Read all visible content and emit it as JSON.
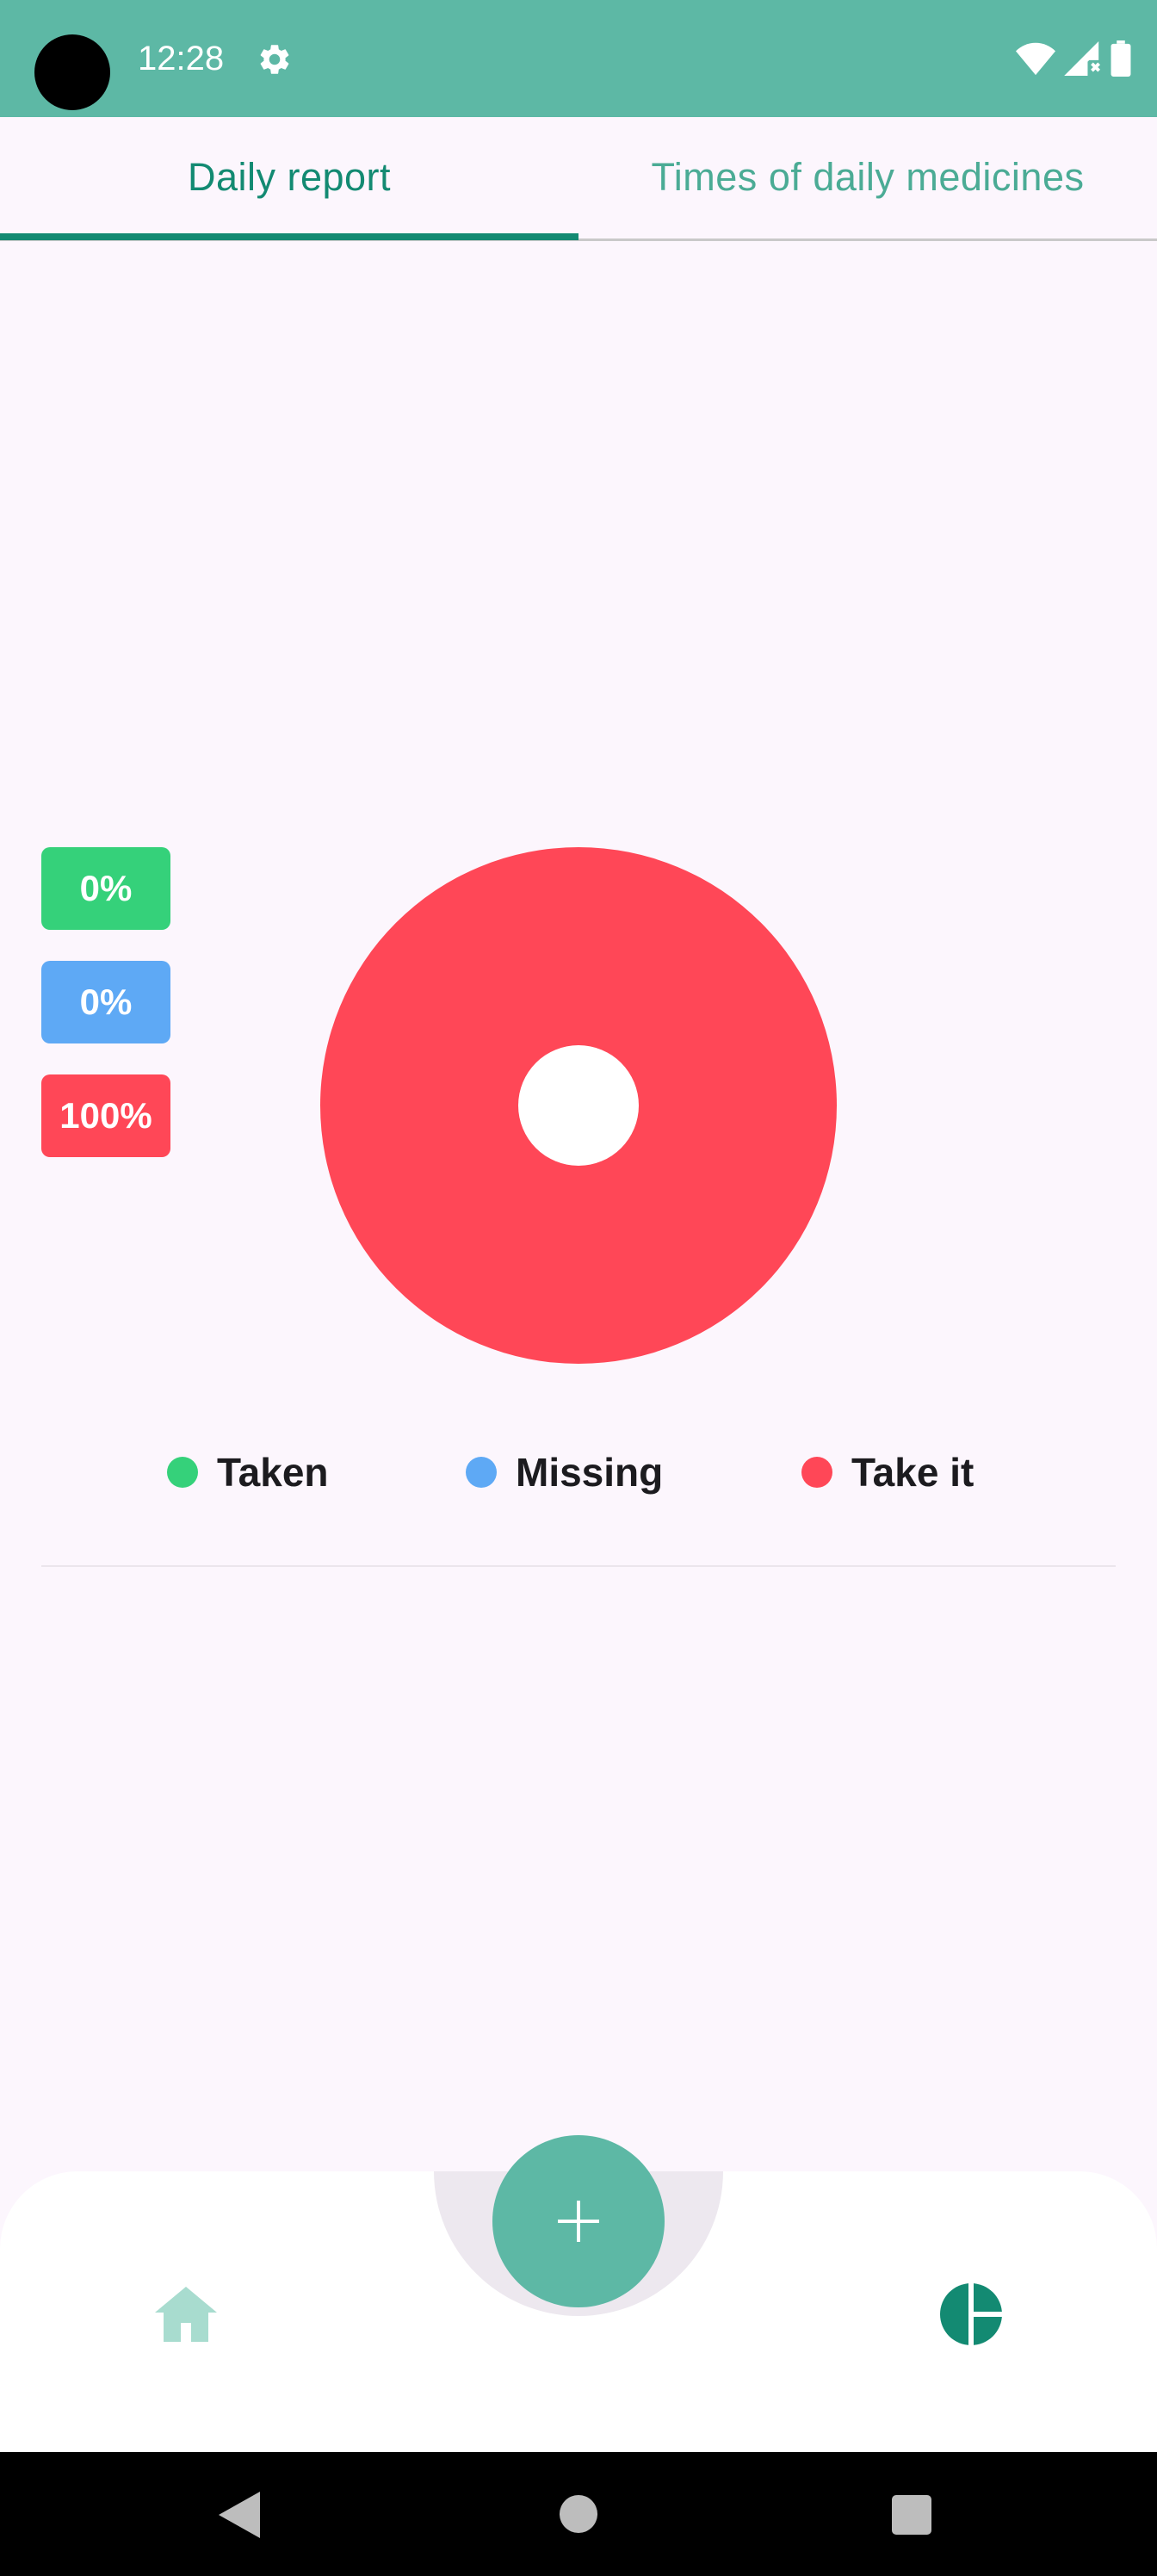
{
  "status_bar": {
    "time": "12:28",
    "icons": [
      "settings-icon",
      "wifi-icon",
      "signal-icon",
      "battery-icon"
    ]
  },
  "tabs": [
    {
      "label": "Daily report",
      "active": true
    },
    {
      "label": "Times of daily medicines",
      "active": false
    }
  ],
  "report": {
    "badges": [
      {
        "label": "0%",
        "color": "#35d17a"
      },
      {
        "label": "0%",
        "color": "#5ea9f5"
      },
      {
        "label": "100%",
        "color": "#ff4757"
      }
    ]
  },
  "chart_data": {
    "type": "pie",
    "categories": [
      "Taken",
      "Missing",
      "Take it"
    ],
    "values": [
      0,
      0,
      100
    ],
    "colors": [
      "#35d17a",
      "#5ea9f5",
      "#ff4757"
    ],
    "donut": true,
    "legend_position": "bottom"
  },
  "legend": [
    {
      "label": "Taken",
      "color": "#35d17a"
    },
    {
      "label": "Missing",
      "color": "#5ea9f5"
    },
    {
      "label": "Take it",
      "color": "#ff4757"
    }
  ],
  "bottom_nav": {
    "fab_icon": "plus-icon",
    "items": [
      {
        "icon": "home-icon",
        "active": false
      },
      {
        "icon": "pie-chart-icon",
        "active": true
      }
    ]
  },
  "colors": {
    "primary": "#5db8a5",
    "primary_dark": "#138a72",
    "background": "#fcf6fd"
  }
}
